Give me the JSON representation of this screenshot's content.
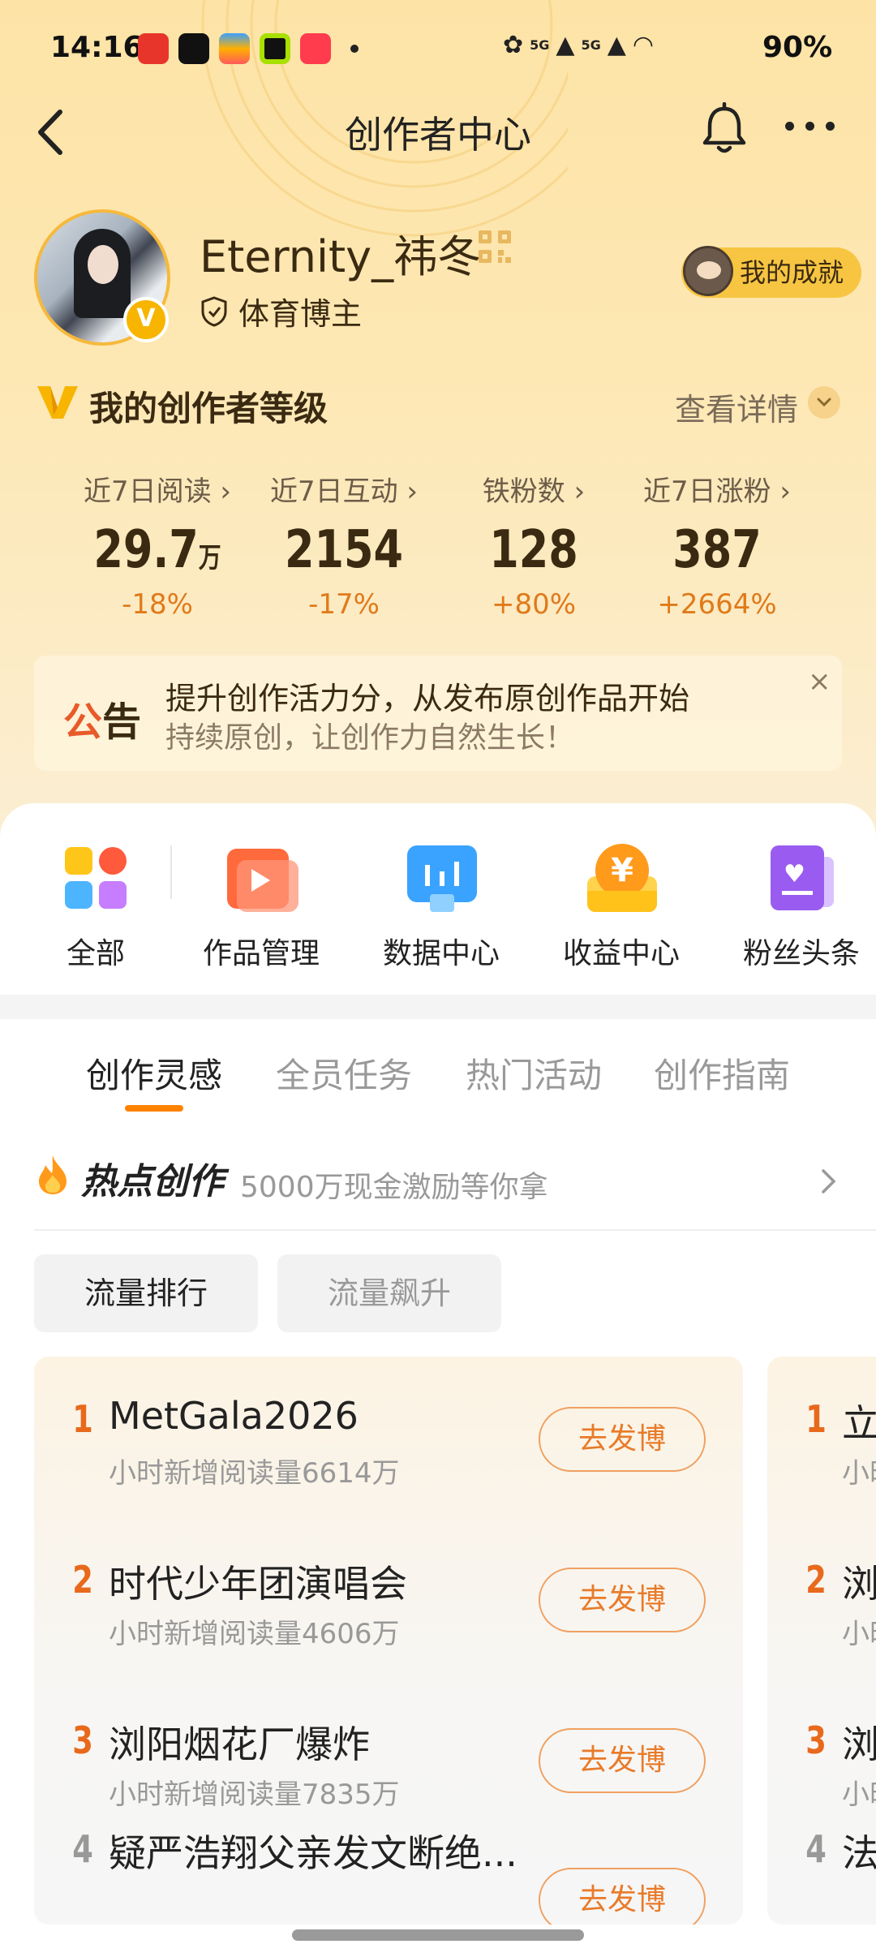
{
  "status_bar": {
    "time": "14:16",
    "net1": "5G",
    "net2": "5G",
    "battery": "90%"
  },
  "nav": {
    "title": "创作者中心"
  },
  "profile": {
    "username": "Eternity_祎冬",
    "verified_label": "体育博主",
    "achievement_label": "我的成就"
  },
  "level": {
    "title": "我的创作者等级",
    "detail_link": "查看详情"
  },
  "stats": [
    {
      "label": "近7日阅读",
      "value": "29.7",
      "unit": "万",
      "change": "-18%"
    },
    {
      "label": "近7日互动",
      "value": "2154",
      "unit": "",
      "change": "-17%"
    },
    {
      "label": "铁粉数",
      "value": "128",
      "unit": "",
      "change": "+80%"
    },
    {
      "label": "近7日涨粉",
      "value": "387",
      "unit": "",
      "change": "+2664%"
    }
  ],
  "notice": {
    "tag_first": "公",
    "tag_second": "告",
    "line1": "提升创作活力分，从发布原创作品开始",
    "line2": "持续原创，让创作力自然生长！",
    "close": "×"
  },
  "tools": [
    {
      "label": "全部",
      "icon": "grid-icon"
    },
    {
      "label": "作品管理",
      "icon": "video-play-icon"
    },
    {
      "label": "数据中心",
      "icon": "bar-chart-icon"
    },
    {
      "label": "收益中心",
      "icon": "yuan-coin-icon"
    },
    {
      "label": "粉丝头条",
      "icon": "heart-card-icon"
    }
  ],
  "tabs": [
    "创作灵感",
    "全员任务",
    "热门活动",
    "创作指南"
  ],
  "hot": {
    "title": "热点创作",
    "subtitle": "5000万现金激励等你拿",
    "chips": [
      "流量排行",
      "流量飙升"
    ]
  },
  "card1": [
    {
      "rank": "1",
      "title": "MetGala2026",
      "sub": "小时新增阅读量6614万",
      "button": "去发博"
    },
    {
      "rank": "2",
      "title": "时代少年团演唱会",
      "sub": "小时新增阅读量4606万",
      "button": "去发博"
    },
    {
      "rank": "3",
      "title": "浏阳烟花厂爆炸",
      "sub": "小时新增阅读量7835万",
      "button": "去发博"
    },
    {
      "rank": "4",
      "title": "疑严浩翔父亲发文断绝...",
      "sub": "",
      "button": "去发博"
    }
  ],
  "card2": [
    {
      "rank": "1",
      "title": "立",
      "sub": "小时"
    },
    {
      "rank": "2",
      "title": "浏",
      "sub": "小时"
    },
    {
      "rank": "3",
      "title": "浏",
      "sub": "小时"
    },
    {
      "rank": "4",
      "title": "法",
      "sub": ""
    }
  ],
  "colors": {
    "accent": "#ff8200",
    "rank_top": "#e8691c",
    "rank_other": "#999999",
    "hero_bg": "#fde3a6"
  }
}
